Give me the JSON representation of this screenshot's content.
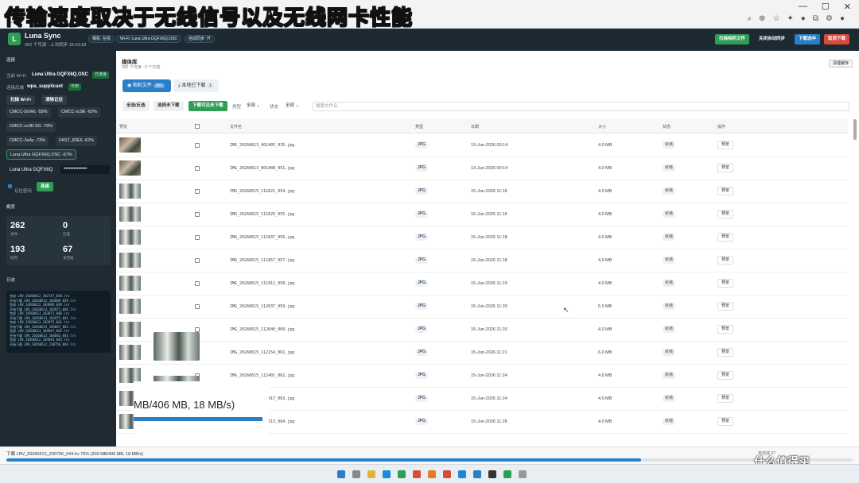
{
  "caption": "传输速度取决于无线信号以及无线网卡性能",
  "header": {
    "logo": "L",
    "title": "Luna Sync",
    "subtitle": "262 个可读 · 上次同步 16:10:18",
    "pills": [
      "相机: 在线",
      "Wi-Fi: Luna Ultra GQFX6Q.OSC",
      "自动同步: 开"
    ],
    "buttons": [
      {
        "label": "扫描相机文件",
        "color": "#2e9e55"
      },
      {
        "label": "关闭自动同步",
        "color": "#1e2a33"
      },
      {
        "label": "下载选中",
        "color": "#2a7fc7"
      },
      {
        "label": "取消下载",
        "color": "#d84a3a"
      }
    ]
  },
  "sidebar": {
    "connection_title": "连接",
    "current_wifi_label": "当前 Wi-Fi",
    "current_wifi": "Luna Ultra GQFX6Q.OSC",
    "current_wifi_tag": "已连接",
    "backend_label": "连接后端",
    "backend": "wpa_supplicant",
    "backend_tag": "可用",
    "scan_btn": "扫描 Wi-Fi",
    "clear_btn": "清除记住",
    "networks": [
      "CMCC-DnWc -58%",
      "CMCC-xc9E -62%",
      "CMCC-xc9E-5G -79%",
      "CMCC-2eAy -73%",
      "FAST_82E6 -62%",
      "Luna Ultra GQFX6Q.OSC -67%"
    ],
    "ssid_value": "Luna Ultra GQFX6Q",
    "password_value": "••••••••••••••",
    "remember_label": "记住密码",
    "connect_btn": "连接",
    "overview_title": "概览",
    "stats": [
      {
        "num": "262",
        "label": "文件"
      },
      {
        "num": "0",
        "label": "已选"
      },
      {
        "num": "193",
        "label": "队列"
      },
      {
        "num": "67",
        "label": "未完成"
      }
    ],
    "log_title": "日志",
    "log": [
      "完成 LRV_20260612_182747_038.lrv",
      "开始下载 LRV_20260612_183809_039.lrv",
      "完成 LRV_20260612_183809_039.lrv",
      "开始下载 LRV_20260613_183871_040.lrv",
      "完成 LRV_20260613_183871_040.lrv",
      "开始下载 LRV_20260613_183975_041.lrv",
      "完成 LRV_20260613_183975_041.lrv",
      "开始下载 LRV_20260613_184047_042.lrv",
      "完成 LRV_20260613_184047_042.lrv",
      "开始下载 LRV_20260613_184043_043.lrv",
      "完成 LRV_20260612_184043_043.lrv",
      "开始下载 LRV_20260612_230756_044.lrv"
    ]
  },
  "main": {
    "title": "媒体库",
    "subtitle": "262 个可读 · 0 个已选",
    "storage_btn": "清理缓存",
    "tab_camera": "相机文件",
    "tab_camera_count": "262",
    "tab_local": "本地已下载",
    "tab_local_count": "1",
    "btn_select_all": "全选/反选",
    "btn_select_undl": "选择未下载",
    "btn_download_visible": "下载可见未下载",
    "type_label": "类型",
    "type_value": "全部",
    "status_label": "状态",
    "status_value": "全部",
    "search_placeholder": "搜索文件名",
    "columns": [
      "预览",
      "",
      "文件名",
      "类型",
      "日期",
      "大小",
      "状态",
      "操作"
    ],
    "rows": [
      {
        "name": "IMG_20260613_001405_035.jpg",
        "type": "JPG",
        "date": "13-Jun-2026 00:14",
        "size": "4.0 MB",
        "status": "就绪",
        "action": "预览",
        "thumb": "a"
      },
      {
        "name": "IMG_20260613_001408_051.jpg",
        "type": "JPG",
        "date": "13-Jun-2026 00:14",
        "size": "4.0 MB",
        "status": "就绪",
        "action": "预览",
        "thumb": "a"
      },
      {
        "name": "IMG_20260615_111621_054.jpg",
        "type": "JPG",
        "date": "15-Jun-2026 11:16",
        "size": "4.0 MB",
        "status": "就绪",
        "action": "预览",
        "thumb": "b"
      },
      {
        "name": "IMG_20260615_111625_055.jpg",
        "type": "JPG",
        "date": "15-Jun-2026 11:16",
        "size": "4.0 MB",
        "status": "就绪",
        "action": "预览",
        "thumb": "b"
      },
      {
        "name": "IMG_20260615_111837_056.jpg",
        "type": "JPG",
        "date": "15-Jun-2026 11:18",
        "size": "4.0 MB",
        "status": "就绪",
        "action": "预览",
        "thumb": "b"
      },
      {
        "name": "IMG_20260615_111857_057.jpg",
        "type": "JPG",
        "date": "15-Jun-2026 11:18",
        "size": "4.0 MB",
        "status": "就绪",
        "action": "预览",
        "thumb": "b"
      },
      {
        "name": "IMG_20260615_111912_058.jpg",
        "type": "JPG",
        "date": "15-Jun-2026 11:19",
        "size": "4.0 MB",
        "status": "就绪",
        "action": "预览",
        "thumb": "b"
      },
      {
        "name": "IMG_20260615_112037_059.jpg",
        "type": "JPG",
        "date": "15-Jun-2026 11:20",
        "size": "5.0 MB",
        "status": "就绪",
        "action": "预览",
        "thumb": "b"
      },
      {
        "name": "IMG_20260615_112040_060.jpg",
        "type": "JPG",
        "date": "15-Jun-2026 11:20",
        "size": "4.0 MB",
        "status": "就绪",
        "action": "预览",
        "thumb": "b"
      },
      {
        "name": "IMG_20260615_112154_061.jpg",
        "type": "JPG",
        "date": "15-Jun-2026 11:21",
        "size": "6.0 MB",
        "status": "就绪",
        "action": "预览",
        "thumb": "b"
      },
      {
        "name": "IMG_20260615_112401_062.jpg",
        "type": "JPG",
        "date": "15-Jun-2026 11:24",
        "size": "4.0 MB",
        "status": "就绪",
        "action": "预览",
        "thumb": "b"
      },
      {
        "name": "IMG_20260615_112417_063.jpg",
        "type": "JPG",
        "date": "15-Jun-2026 11:24",
        "size": "4.0 MB",
        "status": "就绪",
        "action": "预览",
        "thumb": "b"
      },
      {
        "name": "IMG_20260615_112613_064.jpg",
        "type": "JPG",
        "date": "15-Jun-2026 11:26",
        "size": "4.0 MB",
        "status": "就绪",
        "action": "预览",
        "thumb": "b"
      }
    ]
  },
  "footer": {
    "progress_text": "下载 LRV_20260612_230756_044.lrv 75% (303 MB/406 MB, 18 MB/s)",
    "progress_pct": 75,
    "right_text": "未完成 67",
    "zoom_text": "MB/406 MB, 18 MB/s)"
  },
  "watermark": "什么值得买",
  "colors": {
    "accent_green": "#2e9e55",
    "accent_blue": "#2a7fc7",
    "danger": "#d84a3a",
    "dark": "#1e2a33"
  }
}
